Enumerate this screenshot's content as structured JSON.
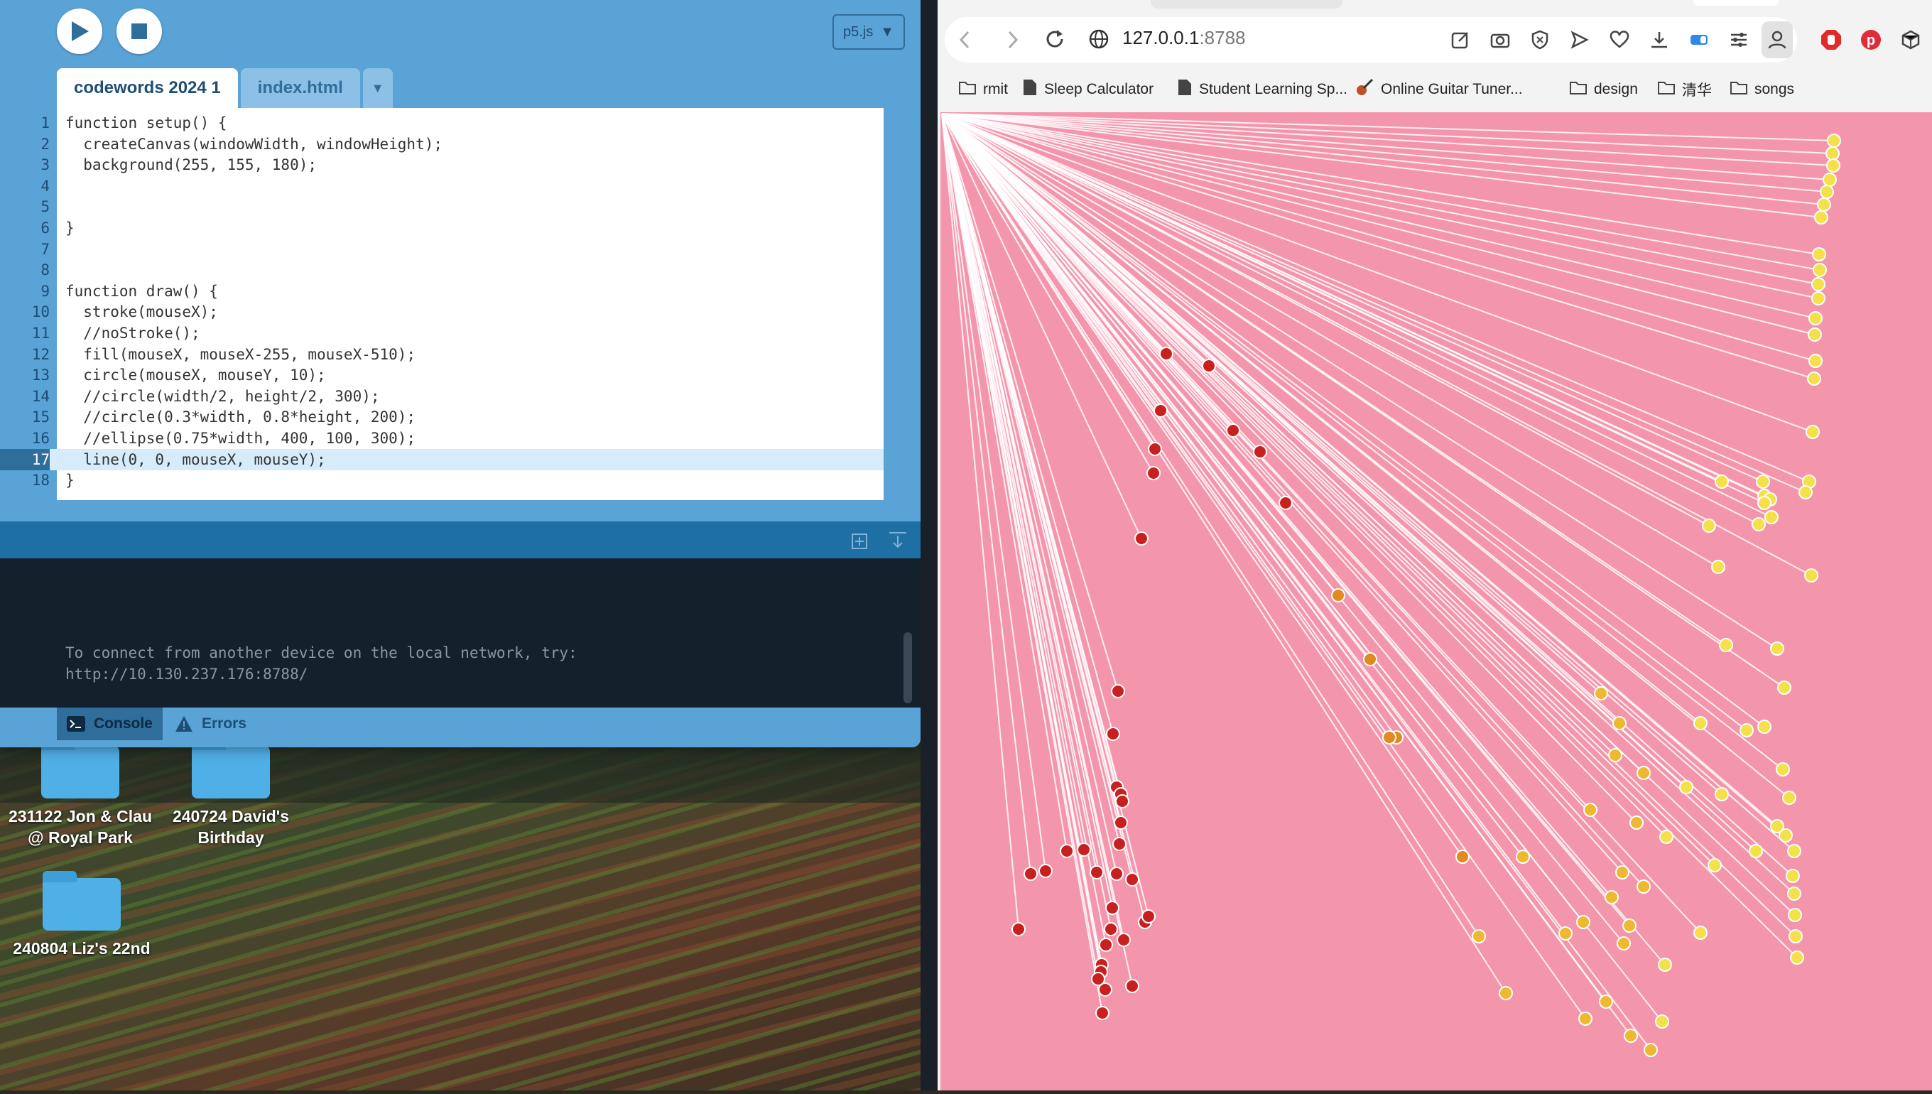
{
  "editor": {
    "library_label": "p5.js",
    "tabs": [
      {
        "label": "codewords 2024 1",
        "active": true
      },
      {
        "label": "index.html",
        "active": false
      }
    ],
    "code_lines": [
      {
        "n": "1",
        "text": "function setup() {"
      },
      {
        "n": "2",
        "text": "  createCanvas(windowWidth, windowHeight);"
      },
      {
        "n": "3",
        "text": "  background(255, 155, 180);"
      },
      {
        "n": "4",
        "text": ""
      },
      {
        "n": "5",
        "text": ""
      },
      {
        "n": "6",
        "text": "}"
      },
      {
        "n": "7",
        "text": ""
      },
      {
        "n": "8",
        "text": ""
      },
      {
        "n": "9",
        "text": "function draw() {"
      },
      {
        "n": "10",
        "text": "  stroke(mouseX);"
      },
      {
        "n": "11",
        "text": "  //noStroke();"
      },
      {
        "n": "12",
        "text": "  fill(mouseX, mouseX-255, mouseX-510);"
      },
      {
        "n": "13",
        "text": "  circle(mouseX, mouseY, 10);"
      },
      {
        "n": "14",
        "text": "  //circle(width/2, height/2, 300);"
      },
      {
        "n": "15",
        "text": "  //circle(0.3*width, 0.8*height, 200);"
      },
      {
        "n": "16",
        "text": "  //ellipse(0.75*width, 400, 100, 300);"
      },
      {
        "n": "17",
        "text": "  line(0, 0, mouseX, mouseY);"
      },
      {
        "n": "18",
        "text": "}"
      }
    ],
    "highlighted_line": 17,
    "console_text": "To connect from another device on the local network, try:\nhttp://10.130.237.176:8788/",
    "console_tabs": {
      "console": "Console",
      "errors": "Errors"
    }
  },
  "desktop": {
    "items": [
      {
        "label": "231122 Jon & Clau @ Royal Park"
      },
      {
        "label": "240724 David's Birthday"
      },
      {
        "label": "240804 Liz's 22nd"
      }
    ]
  },
  "browser": {
    "url_host": "127.0.0.1",
    "url_port": ":8788",
    "bookmarks": [
      {
        "label": "rmit",
        "icon": "folder-icon"
      },
      {
        "label": "Sleep Calculator",
        "icon": "page-icon"
      },
      {
        "label": "Student Learning Sp...",
        "icon": "page-icon"
      },
      {
        "label": "Online Guitar Tuner...",
        "icon": "guitar-icon"
      },
      {
        "label": "design",
        "icon": "folder-icon"
      },
      {
        "label": "清华",
        "icon": "folder-icon"
      },
      {
        "label": "songs",
        "icon": "folder-icon"
      }
    ]
  },
  "colors": {
    "canvas_bg": "#f496ab",
    "editor_bg": "#5aa3d6",
    "console_bg": "#14202c"
  }
}
